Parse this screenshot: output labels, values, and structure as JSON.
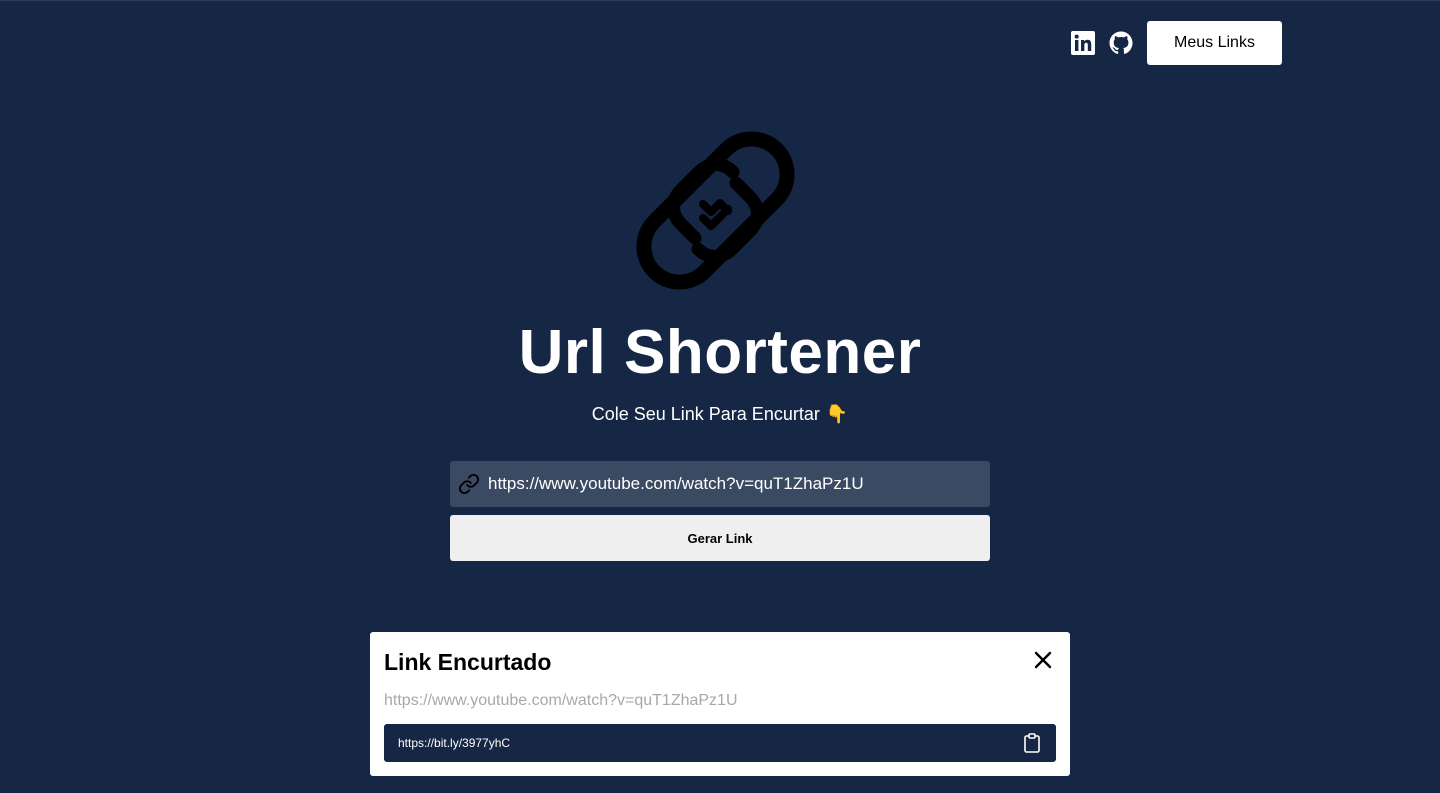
{
  "header": {
    "social": [
      {
        "name": "linkedin-icon"
      },
      {
        "name": "github-icon"
      }
    ],
    "my_links_label": "Meus Links"
  },
  "hero": {
    "title": "Url Shortener",
    "subtitle": "Cole Seu Link Para Encurtar",
    "subtitle_emoji": "👇"
  },
  "form": {
    "url_value": "https://www.youtube.com/watch?v=quT1ZhaPz1U",
    "generate_label": "Gerar Link"
  },
  "result": {
    "title": "Link Encurtado",
    "original_url": "https://www.youtube.com/watch?v=quT1ZhaPz1U",
    "short_url": "https://bit.ly/3977yhC"
  },
  "colors": {
    "background": "#152744",
    "input_bg": "#3a4a62",
    "button_bg": "#efeff0",
    "card_bg": "#ffffff"
  }
}
